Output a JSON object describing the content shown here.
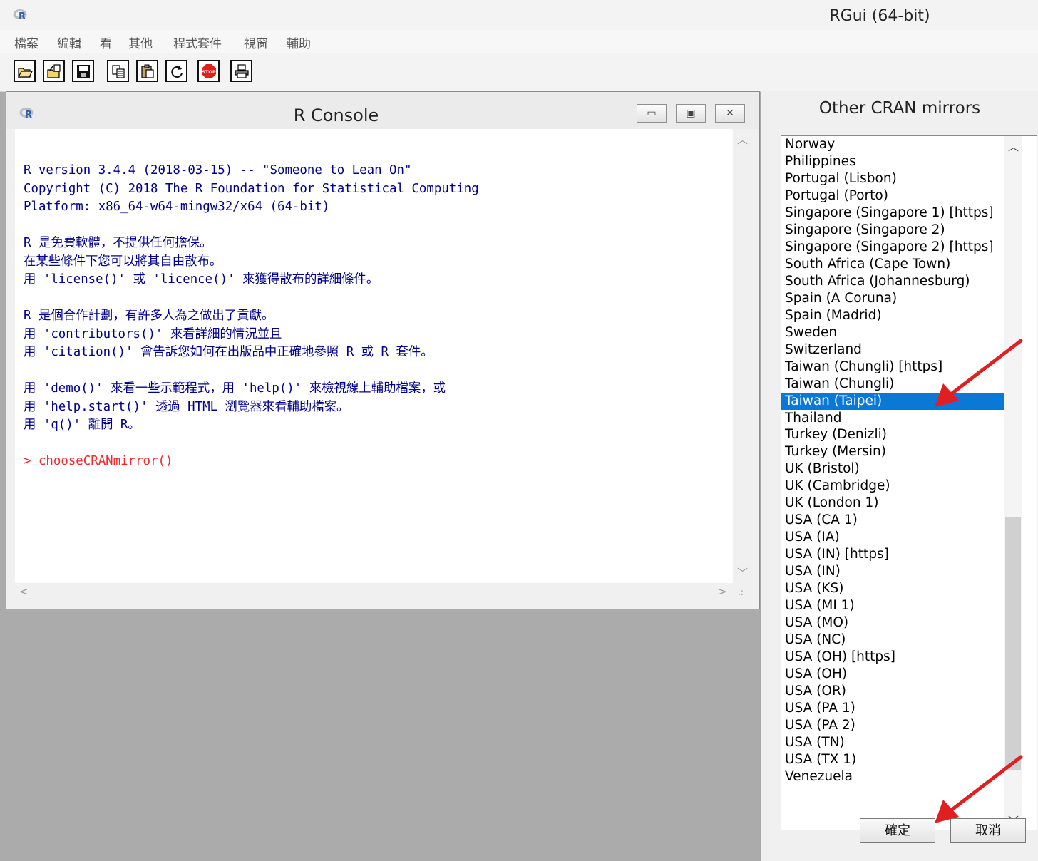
{
  "window": {
    "title": "RGui (64-bit)"
  },
  "menu": [
    "檔案",
    "編輯",
    "看",
    "其他",
    "程式套件",
    "視窗",
    "輔助"
  ],
  "toolbar": [
    {
      "name": "open-script-icon"
    },
    {
      "name": "load-workspace-icon"
    },
    {
      "name": "save-workspace-icon"
    },
    {
      "name": "copy-icon"
    },
    {
      "name": "paste-icon"
    },
    {
      "name": "copy-paste-icon"
    },
    {
      "name": "stop-icon",
      "label": "STOP"
    },
    {
      "name": "print-icon"
    }
  ],
  "console": {
    "title": "R Console",
    "lines": [
      "R version 3.4.4 (2018-03-15) -- \"Someone to Lean On\"",
      "Copyright (C) 2018 The R Foundation for Statistical Computing",
      "Platform: x86_64-w64-mingw32/x64 (64-bit)",
      "",
      "R 是免費軟體，不提供任何擔保。",
      "在某些條件下您可以將其自由散布。",
      "用 'license()' 或 'licence()' 來獲得散布的詳細條件。",
      "",
      "R 是個合作計劃，有許多人為之做出了貢獻。",
      "用 'contributors()' 來看詳細的情況並且",
      "用 'citation()' 會告訴您如何在出版品中正確地參照 R 或 R 套件。",
      "",
      "用 'demo()' 來看一些示範程式，用 'help()' 來檢視線上輔助檔案，或",
      "用 'help.start()' 透過 HTML 瀏覽器來看輔助檔案。",
      "用 'q()' 離開 R。",
      ""
    ],
    "prompt": "> chooseCRANmirror()"
  },
  "mirror_dialog": {
    "title": "Other CRAN mirrors",
    "items": [
      "Norway",
      "Philippines",
      "Portugal (Lisbon)",
      "Portugal (Porto)",
      "Singapore (Singapore 1) [https]",
      "Singapore (Singapore 2)",
      "Singapore (Singapore 2) [https]",
      "South Africa (Cape Town)",
      "South Africa (Johannesburg)",
      "Spain (A Coruna)",
      "Spain (Madrid)",
      "Sweden",
      "Switzerland",
      "Taiwan (Chungli) [https]",
      "Taiwan (Chungli)",
      "Taiwan (Taipei)",
      "Thailand",
      "Turkey (Denizli)",
      "Turkey (Mersin)",
      "UK (Bristol)",
      "UK (Cambridge)",
      "UK (London 1)",
      "USA (CA 1)",
      "USA (IA)",
      "USA (IN) [https]",
      "USA (IN)",
      "USA (KS)",
      "USA (MI 1)",
      "USA (MO)",
      "USA (NC)",
      "USA (OH) [https]",
      "USA (OH)",
      "USA (OR)",
      "USA (PA 1)",
      "USA (PA 2)",
      "USA (TN)",
      "USA (TX 1)",
      "Venezuela"
    ],
    "selected": "Taiwan (Taipei)",
    "ok_label": "確定",
    "cancel_label": "取消"
  },
  "colors": {
    "selection": "#0a78d7",
    "console_text": "#00008b",
    "prompt": "#ee2a2a",
    "annotation_arrow": "#e02020"
  }
}
